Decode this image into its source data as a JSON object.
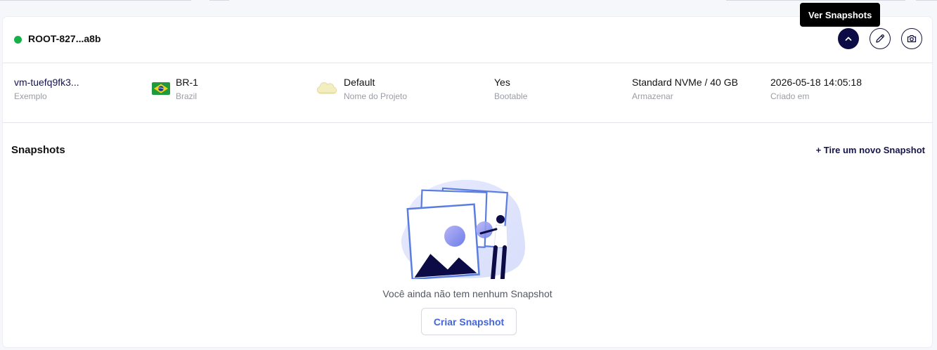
{
  "volume": {
    "name": "ROOT-827...a8b",
    "status_color": "#18b04a"
  },
  "tooltip": "Ver Snapshots",
  "header_buttons": {
    "collapse_icon": "chevron-up-icon",
    "edit_icon": "pencil-icon",
    "snapshot_icon": "camera-icon"
  },
  "details": [
    {
      "value": "vm-tuefq9fk3...",
      "label": "Exemplo"
    },
    {
      "value": "BR-1",
      "label": "Brazil",
      "icon": "brazil-flag-icon"
    },
    {
      "value": "Default",
      "label": "Nome do Projeto",
      "icon": "cloud-icon"
    },
    {
      "value": "Yes",
      "label": "Bootable"
    },
    {
      "value": "Standard NVMe / 40 GB",
      "label": "Armazenar"
    },
    {
      "value": "2026-05-18 14:05:18",
      "label": "Criado em"
    }
  ],
  "snapshots": {
    "title": "Snapshots",
    "new_link": "+ Tire um novo Snapshot",
    "empty_text": "Você ainda não tem nenhum Snapshot",
    "create_button": "Criar Snapshot"
  },
  "colors": {
    "primary": "#0c0b45",
    "accent": "#4566d9",
    "status_active": "#18b04a"
  }
}
